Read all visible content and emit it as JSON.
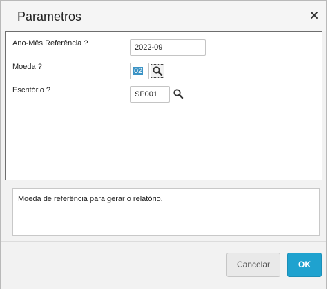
{
  "dialog": {
    "title": "Parametros",
    "close_icon": "close-icon"
  },
  "form": {
    "ano_mes": {
      "label": "Ano-Mês Referência ?",
      "value": "2022-09"
    },
    "moeda": {
      "label": "Moeda ?",
      "value": "02",
      "lookup_icon": "search-icon"
    },
    "escritorio": {
      "label": "Escritório ?",
      "value": "SP001",
      "lookup_icon": "search-icon"
    }
  },
  "help": {
    "text": "Moeda de referência para gerar o relatório."
  },
  "footer": {
    "cancel_label": "Cancelar",
    "ok_label": "OK"
  },
  "colors": {
    "accent": "#1fa2cf",
    "selection": "#3b93c5"
  }
}
